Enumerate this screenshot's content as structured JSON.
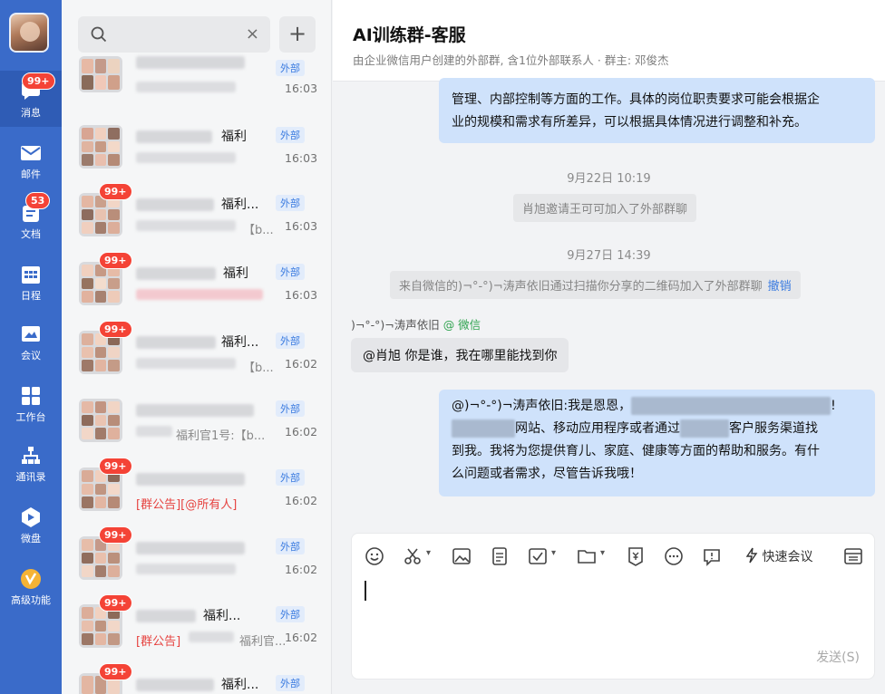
{
  "nav": {
    "items": [
      {
        "label": "消息",
        "badge": "99+",
        "icon": "chat-icon"
      },
      {
        "label": "邮件",
        "badge": "",
        "icon": "mail-icon"
      },
      {
        "label": "文档",
        "badge": "53",
        "icon": "doc-icon"
      },
      {
        "label": "日程",
        "badge": "",
        "icon": "calendar-icon"
      },
      {
        "label": "会议",
        "badge": "",
        "icon": "meeting-icon"
      },
      {
        "label": "工作台",
        "badge": "",
        "icon": "workbench-icon"
      },
      {
        "label": "通讯录",
        "badge": "",
        "icon": "contacts-icon"
      },
      {
        "label": "微盘",
        "badge": "",
        "icon": "drive-icon"
      },
      {
        "label": "高级功能",
        "badge": "",
        "icon": "premium-icon"
      }
    ]
  },
  "search": {
    "clear": "×",
    "add": "+"
  },
  "conversations": [
    {
      "name": "",
      "sub": "",
      "tag": "外部",
      "time": "16:03",
      "badge": ""
    },
    {
      "name": "福利",
      "sub": "",
      "tag": "外部",
      "time": "16:03",
      "badge": ""
    },
    {
      "name": "福利...",
      "sub": "【b...",
      "tag": "外部",
      "time": "16:03",
      "badge": "99+"
    },
    {
      "name": "福利",
      "sub": "",
      "tag": "外部",
      "time": "16:03",
      "badge": "99+"
    },
    {
      "name": "福利...",
      "sub": "【b...",
      "tag": "外部",
      "time": "16:02",
      "badge": "99+"
    },
    {
      "name": "",
      "sub": "福利官1号:【b...",
      "tag": "外部",
      "time": "16:02",
      "badge": ""
    },
    {
      "name": "",
      "sub": "[群公告][@所有人]",
      "tag": "外部",
      "time": "16:02",
      "badge": "99+"
    },
    {
      "name": "",
      "sub": "",
      "tag": "外部",
      "time": "16:02",
      "badge": "99+"
    },
    {
      "name": "福利...",
      "sub": "[群公告]",
      "sub2": "福利官...",
      "tag": "外部",
      "time": "16:02",
      "badge": "99+"
    },
    {
      "name": "福利...",
      "sub": "",
      "tag": "外部",
      "time": "",
      "badge": "99+"
    }
  ],
  "chat": {
    "title": "AI训练群-客服",
    "subtitle": "由企业微信用户创建的外部群, 含1位外部联系人 · 群主: 邓俊杰",
    "top_bubble": [
      "管理、内部控制等方面的工作。具体的岗位职责要求可能会根据企",
      "业的规模和需求有所差异，可以根据具体情况进行调整和补充。"
    ],
    "time1": "9月22日 10:19",
    "sys1": "肖旭邀请王可可加入了外部群聊",
    "time2": "9月27日 14:39",
    "sys2": "来自微信的)¬°-°)¬涛声依旧通过扫描你分享的二维码加入了外部群聊",
    "sys2_undo": "撤销",
    "sender_name": ")¬°-°)¬涛声依旧",
    "sender_source": "@ 微信",
    "left_bubble": "@肖旭 你是谁，我在哪里能找到你",
    "reply": {
      "line1a": "@)¬°-°)¬涛声依旧:我是恩恩，",
      "line1b": "!",
      "line2a": "网站、移动应用程序或者通过",
      "line2b": "客户服务渠道找",
      "line3": "到我。我将为您提供育儿、家庭、健康等方面的帮助和服务。有什",
      "line4": "么问题或者需求，尽管告诉我哦！"
    }
  },
  "composer": {
    "quick_meeting": "快速会议",
    "send": "发送(S)"
  }
}
